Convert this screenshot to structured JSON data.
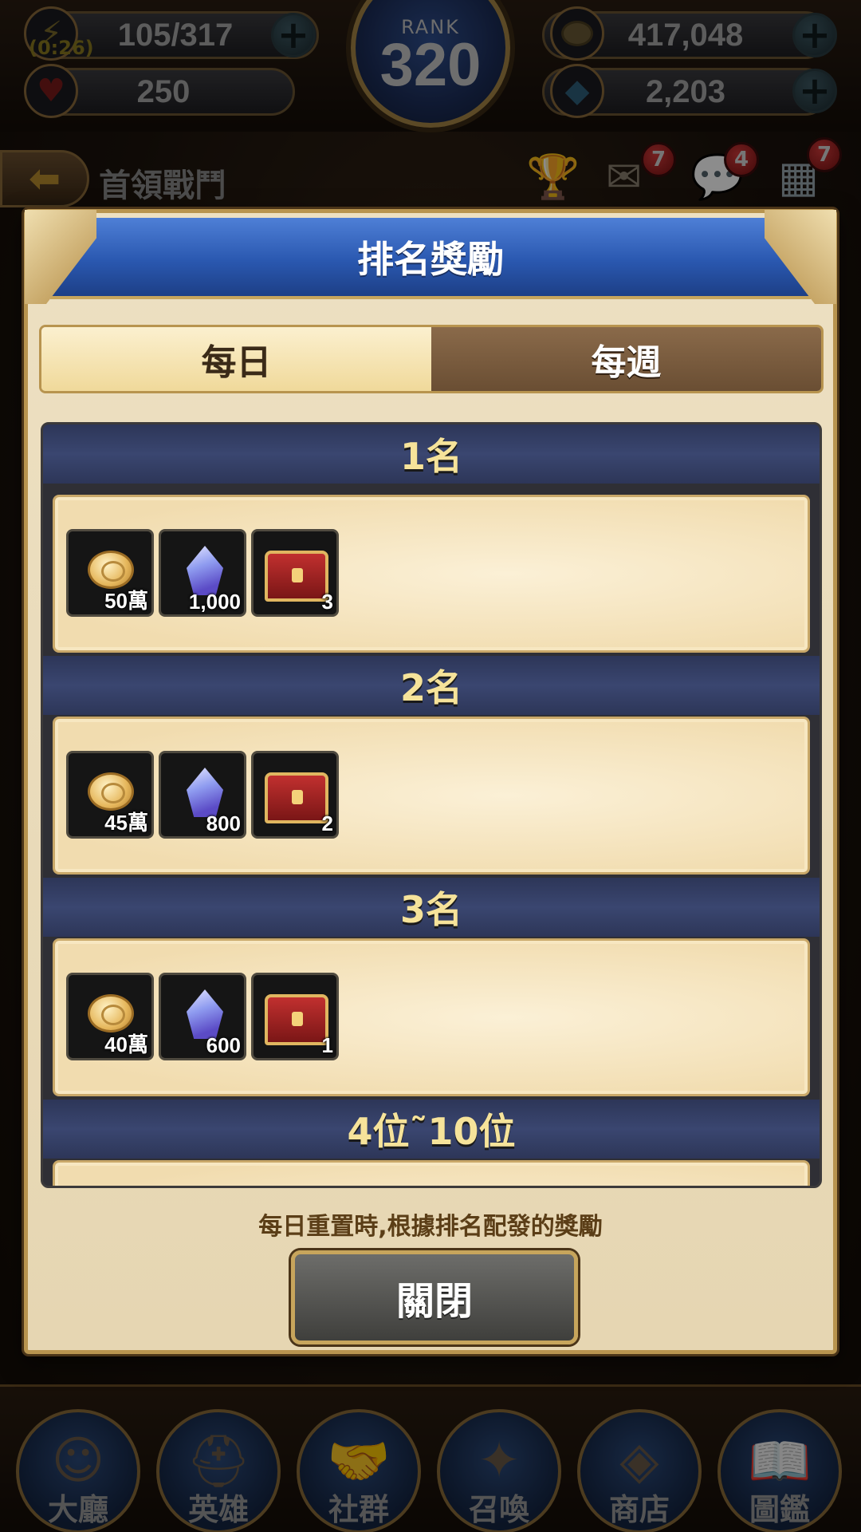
{
  "status": {
    "stamina": "105/317",
    "stamina_timer": "(0:26)",
    "hearts": "250",
    "rank_label": "RANK",
    "rank_value": "320",
    "gold": "417,048",
    "gems": "2,203"
  },
  "header": {
    "screen_title": "首領戰鬥",
    "mail_badge": "7",
    "chat_badge": "4",
    "menu_badge": "7"
  },
  "modal": {
    "title": "排名獎勵",
    "tabs": [
      {
        "label": "每日",
        "active": true
      },
      {
        "label": "每週",
        "active": false
      }
    ],
    "ranks": [
      {
        "label": "1名",
        "rewards": [
          {
            "icon": "gold-coin-icon",
            "qty": "50萬"
          },
          {
            "icon": "crystal-gem-icon",
            "qty": "1,000"
          },
          {
            "icon": "treasure-chest-icon",
            "qty": "3"
          }
        ]
      },
      {
        "label": "2名",
        "rewards": [
          {
            "icon": "gold-coin-icon",
            "qty": "45萬"
          },
          {
            "icon": "crystal-gem-icon",
            "qty": "800"
          },
          {
            "icon": "treasure-chest-icon",
            "qty": "2"
          }
        ]
      },
      {
        "label": "3名",
        "rewards": [
          {
            "icon": "gold-coin-icon",
            "qty": "40萬"
          },
          {
            "icon": "crystal-gem-icon",
            "qty": "600"
          },
          {
            "icon": "treasure-chest-icon",
            "qty": "1"
          }
        ]
      },
      {
        "label": "4位˜10位",
        "rewards": []
      }
    ],
    "footnote": "每日重置時,根據排名配發的獎勵",
    "close_label": "關閉"
  },
  "nav": {
    "items": [
      "大廳",
      "英雄",
      "社群",
      "召喚",
      "商店",
      "圖鑑"
    ]
  },
  "colors": {
    "modal_header_blue": "#2a58b0",
    "gold_trim": "#b8944f",
    "rank_text_yellow": "#f6e39a",
    "badge_red": "#d23a3a"
  }
}
